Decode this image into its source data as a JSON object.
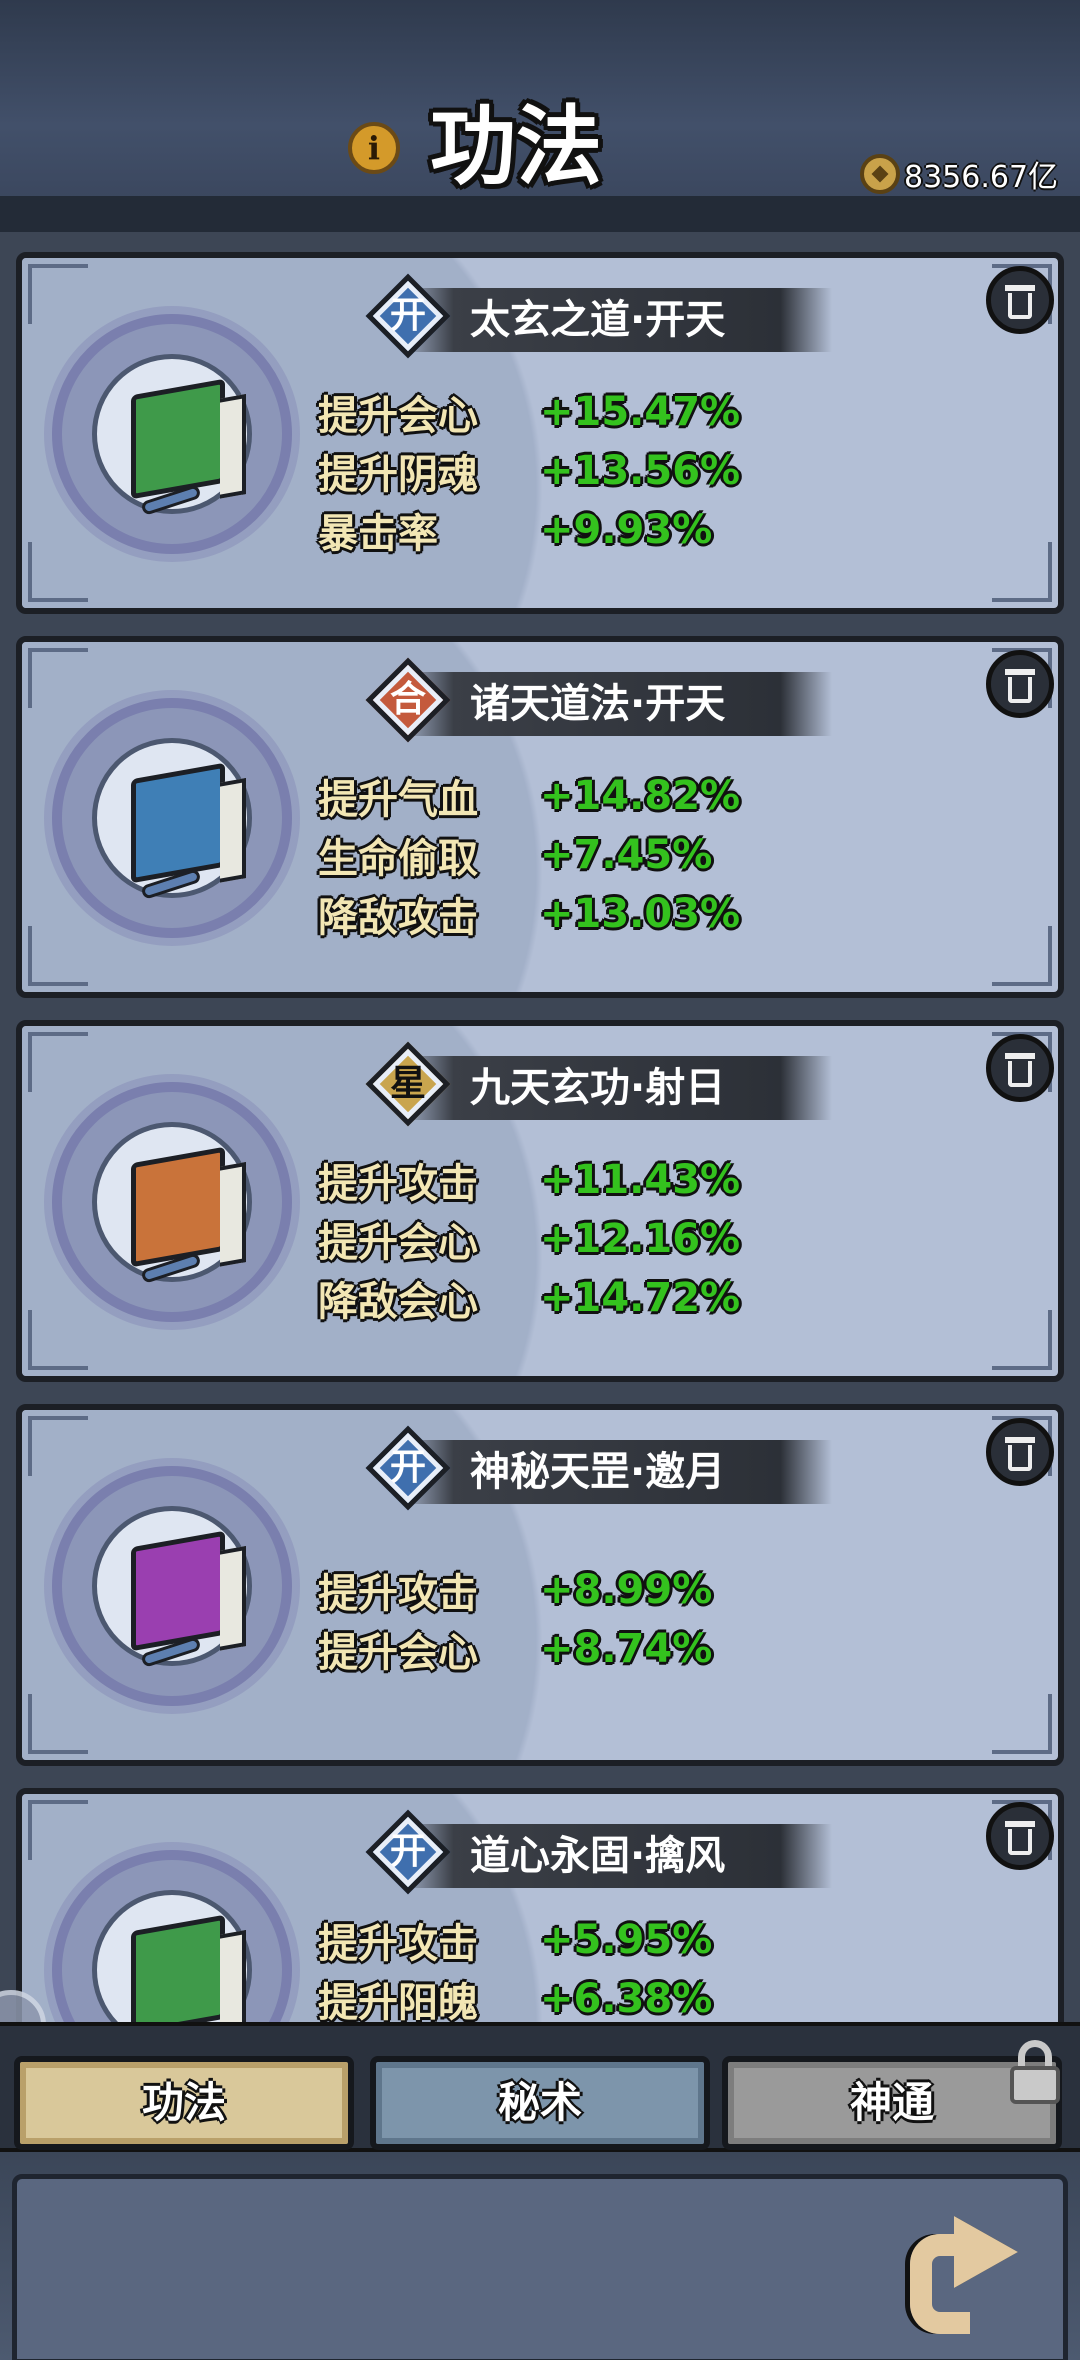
{
  "header": {
    "title": "功法",
    "info_icon": "i",
    "currency": "8356.67亿"
  },
  "colors": {
    "stat_label": "#f2e6b4",
    "stat_value": "#34c21e",
    "grade_kai": "#3f6fae",
    "grade_he": "#c45a3c",
    "grade_xing": "#c9a54e",
    "book_green": "#3f9a4a",
    "book_blue": "#3f7fb6",
    "book_orange": "#c9733a",
    "book_purple": "#9a3fb0"
  },
  "skills": [
    {
      "grade": "开",
      "name": "太玄之道·开天",
      "book_icon": "green-book-icon",
      "stats": [
        {
          "label": "提升会心",
          "value": "+15.47%"
        },
        {
          "label": "提升阴魂",
          "value": "+13.56%"
        },
        {
          "label": "暴击率",
          "value": "+9.93%"
        }
      ]
    },
    {
      "grade": "合",
      "name": "诸天道法·开天",
      "book_icon": "blue-book-icon",
      "stats": [
        {
          "label": "提升气血",
          "value": "+14.82%"
        },
        {
          "label": "生命偷取",
          "value": "+7.45%"
        },
        {
          "label": "降敌攻击",
          "value": "+13.03%"
        }
      ]
    },
    {
      "grade": "星",
      "name": "九天玄功·射日",
      "book_icon": "orange-book-icon",
      "stats": [
        {
          "label": "提升攻击",
          "value": "+11.43%"
        },
        {
          "label": "提升会心",
          "value": "+12.16%"
        },
        {
          "label": "降敌会心",
          "value": "+14.72%"
        }
      ]
    },
    {
      "grade": "开",
      "name": "神秘天罡·邀月",
      "book_icon": "purple-book-icon",
      "stats": [
        {
          "label": "提升攻击",
          "value": "+8.99%"
        },
        {
          "label": "提升会心",
          "value": "+8.74%"
        }
      ]
    },
    {
      "grade": "开",
      "name": "道心永固·擒风",
      "book_icon": "green-book-icon",
      "stats": [
        {
          "label": "提升攻击",
          "value": "+5.95%"
        },
        {
          "label": "提升阳魄",
          "value": "+6.38%"
        }
      ]
    }
  ],
  "tabs": {
    "tab1": "功法",
    "tab2": "秘术",
    "tab3": "神通"
  }
}
